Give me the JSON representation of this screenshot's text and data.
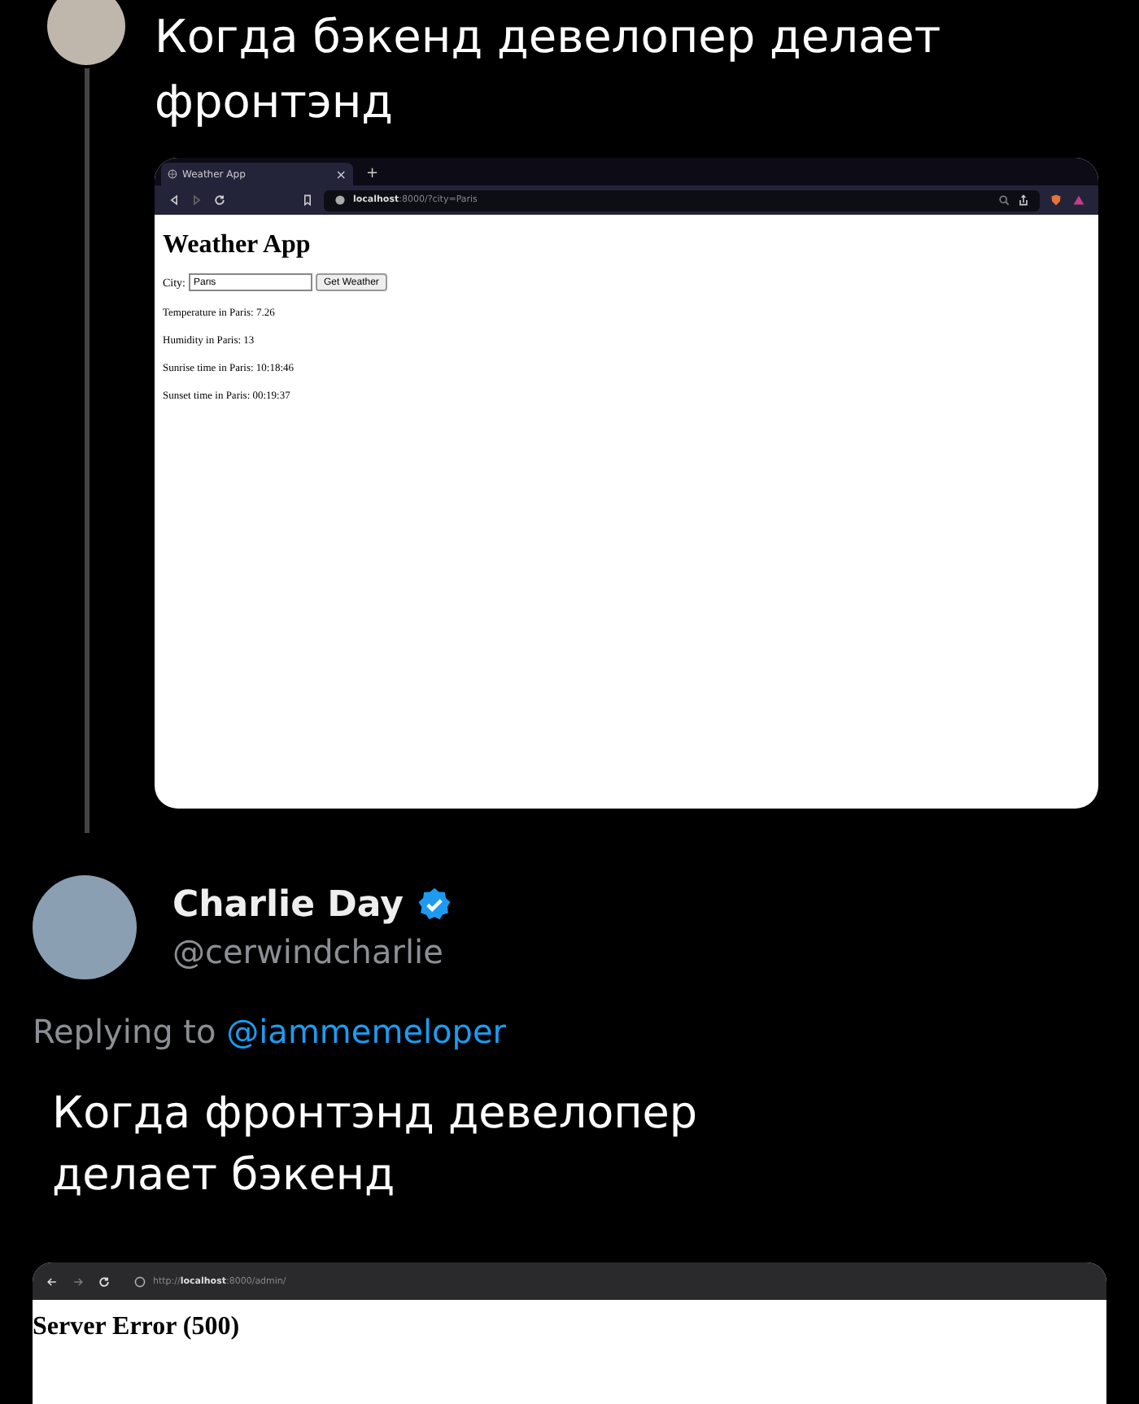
{
  "original_post": {
    "text": "Когда бэкенд девелопер делает фронтэнд",
    "browser": {
      "tab": {
        "title": "Weather App",
        "close": "×",
        "selected": true
      },
      "new_tab": "+",
      "url_host": "localhost",
      "url_rest": ":8000/?city=Paris",
      "page": {
        "heading": "Weather App",
        "city_label": "City:",
        "city_value": "Paris",
        "button": "Get Weather",
        "lines": [
          "Temperature in Paris: 7.26",
          "Humidity in Paris: 13",
          "Sunrise time in Paris: 10:18:46",
          "Sunset time in Paris: 00:19:37"
        ]
      }
    }
  },
  "reply": {
    "name": "Charlie Day",
    "verified": true,
    "handle": "@cerwindcharlie",
    "replying_label": "Replying to",
    "replying_handle": "@iammemeloper",
    "text": "Когда фронтэнд девелопер делает бэкенд",
    "browser": {
      "url_scheme": "http://",
      "url_host": "localhost",
      "url_rest": ":8000/admin/",
      "page": {
        "heading": "Server Error (500)"
      }
    }
  }
}
